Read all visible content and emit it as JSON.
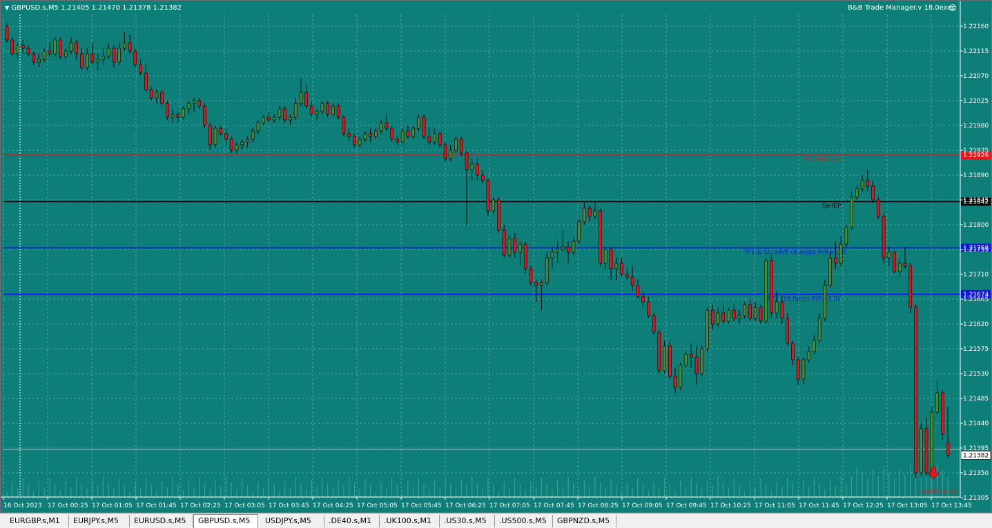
{
  "header": {
    "symbol_info": "GBPUSD.s,M5  1.21405 1.21470 1.21378 1.21382",
    "ea_label": "B&B Trade Manager.v 18.0exec"
  },
  "price_axis": {
    "ticks": [
      "1.22160",
      "1.22115",
      "1.22070",
      "1.22025",
      "1.21980",
      "1.21935",
      "1.21890",
      "1.21845",
      "1.21800",
      "1.21755",
      "1.21710",
      "1.21665",
      "1.21620",
      "1.21575",
      "1.21530",
      "1.21485",
      "1.21440",
      "1.21395",
      "1.21350",
      "1.21305"
    ],
    "current_price": "1.21382"
  },
  "time_axis": {
    "labels": [
      "16 Oct 2023",
      "17 Oct 00:25",
      "17 Oct 01:05",
      "17 Oct 01:45",
      "17 Oct 02:25",
      "17 Oct 03:05",
      "17 Oct 03:45",
      "17 Oct 04:25",
      "17 Oct 05:05",
      "17 Oct 05:45",
      "17 Oct 06:25",
      "17 Oct 07:05",
      "17 Oct 07:45",
      "17 Oct 08:25",
      "17 Oct 09:05",
      "17 Oct 09:45",
      "17 Oct 10:25",
      "17 Oct 11:05",
      "17 Oct 11:45",
      "17 Oct 12:25",
      "17 Oct 13:05",
      "17 Oct 13:45"
    ]
  },
  "levels": [
    {
      "name": "sl",
      "price": 1.21926,
      "price_label": "1.21926",
      "text": "SL (8.4pips)",
      "color": "#e8141a",
      "text_color": "#e8141a"
    },
    {
      "name": "sellep",
      "price": 1.21842,
      "price_label": "1.21842",
      "text": "SellEP",
      "color": "#000000",
      "text_color": "#000000"
    },
    {
      "name": "tp1",
      "price": 1.21758,
      "price_label": "1.21758",
      "text": "TP1 & SL->B/E (8.4pips R/R=1.0)",
      "color": "#0a14e6",
      "text_color": "#0a14e6"
    },
    {
      "name": "tp2",
      "price": 1.21674,
      "price_label": "1.21674",
      "text": "TP2 (16.8pips R/R=2.0)",
      "color": "#0a14e6",
      "text_color": "#0a14e6"
    }
  ],
  "sell_marker": {
    "text": "(5min 12:45)",
    "color": "#e8141a"
  },
  "chart_data": {
    "type": "candlestick",
    "symbol": "GBPUSD.s",
    "timeframe": "M5",
    "ylim": [
      1.213,
      1.2219
    ],
    "up_color": "#4f8a2c",
    "down_color": "#e8141a",
    "grid": true,
    "candles": [
      [
        1.2216,
        1.22165,
        1.2213,
        1.22135
      ],
      [
        1.22135,
        1.2214,
        1.22105,
        1.2211
      ],
      [
        1.2211,
        1.2213,
        1.221,
        1.22125
      ],
      [
        1.22125,
        1.22135,
        1.2211,
        1.2212
      ],
      [
        1.2212,
        1.22125,
        1.22105,
        1.2211
      ],
      [
        1.2211,
        1.22115,
        1.2209,
        1.22095
      ],
      [
        1.22095,
        1.2211,
        1.22085,
        1.221
      ],
      [
        1.221,
        1.2212,
        1.22095,
        1.22115
      ],
      [
        1.22115,
        1.2213,
        1.22105,
        1.2211
      ],
      [
        1.2211,
        1.2214,
        1.22105,
        1.22135
      ],
      [
        1.22135,
        1.2214,
        1.221,
        1.22105
      ],
      [
        1.22105,
        1.2212,
        1.221,
        1.22115
      ],
      [
        1.22115,
        1.2214,
        1.2211,
        1.2213
      ],
      [
        1.2213,
        1.22135,
        1.221,
        1.2211
      ],
      [
        1.2211,
        1.2212,
        1.2208,
        1.22085
      ],
      [
        1.22085,
        1.2212,
        1.2208,
        1.2211
      ],
      [
        1.2211,
        1.2213,
        1.2209,
        1.22095
      ],
      [
        1.22095,
        1.2211,
        1.2208,
        1.221
      ],
      [
        1.221,
        1.2212,
        1.2209,
        1.22105
      ],
      [
        1.22105,
        1.2213,
        1.221,
        1.2212
      ],
      [
        1.2212,
        1.22125,
        1.22085,
        1.22095
      ],
      [
        1.22095,
        1.2213,
        1.2209,
        1.2212
      ],
      [
        1.2212,
        1.2215,
        1.22115,
        1.2213
      ],
      [
        1.2213,
        1.22145,
        1.2211,
        1.22115
      ],
      [
        1.22115,
        1.2212,
        1.22085,
        1.2209
      ],
      [
        1.2209,
        1.221,
        1.2207,
        1.22075
      ],
      [
        1.22075,
        1.2209,
        1.2204,
        1.22045
      ],
      [
        1.22045,
        1.2205,
        1.22025,
        1.2203
      ],
      [
        1.2203,
        1.22045,
        1.2202,
        1.2204
      ],
      [
        1.2204,
        1.22045,
        1.22015,
        1.2202
      ],
      [
        1.2202,
        1.22025,
        1.2199,
        1.21995
      ],
      [
        1.21995,
        1.2201,
        1.21985,
        1.22
      ],
      [
        1.22,
        1.22005,
        1.21985,
        1.21995
      ],
      [
        1.21995,
        1.22015,
        1.2199,
        1.2201
      ],
      [
        1.2201,
        1.22025,
        1.22,
        1.2202
      ],
      [
        1.2202,
        1.2203,
        1.22005,
        1.22025
      ],
      [
        1.22025,
        1.2203,
        1.2201,
        1.22015
      ],
      [
        1.22015,
        1.2202,
        1.21975,
        1.2198
      ],
      [
        1.2198,
        1.21985,
        1.21935,
        1.21945
      ],
      [
        1.21945,
        1.2198,
        1.2194,
        1.21975
      ],
      [
        1.21975,
        1.2198,
        1.2196,
        1.21965
      ],
      [
        1.21965,
        1.21975,
        1.21945,
        1.21955
      ],
      [
        1.21955,
        1.2196,
        1.2193,
        1.21935
      ],
      [
        1.21935,
        1.2195,
        1.2193,
        1.21945
      ],
      [
        1.21945,
        1.21955,
        1.21935,
        1.2195
      ],
      [
        1.2195,
        1.2196,
        1.2194,
        1.21955
      ],
      [
        1.21955,
        1.21975,
        1.2195,
        1.2197
      ],
      [
        1.2197,
        1.2199,
        1.21965,
        1.21985
      ],
      [
        1.21985,
        1.22,
        1.2198,
        1.21995
      ],
      [
        1.21995,
        1.22005,
        1.21985,
        1.2199
      ],
      [
        1.2199,
        1.22,
        1.21985,
        1.21995
      ],
      [
        1.21995,
        1.22015,
        1.2199,
        1.2201
      ],
      [
        1.2201,
        1.22015,
        1.21985,
        1.2199
      ],
      [
        1.2199,
        1.22,
        1.2198,
        1.21995
      ],
      [
        1.21995,
        1.2203,
        1.2199,
        1.2202
      ],
      [
        1.2202,
        1.22065,
        1.22015,
        1.2204
      ],
      [
        1.2204,
        1.22055,
        1.2201,
        1.22015
      ],
      [
        1.22015,
        1.22025,
        1.21995,
        1.22
      ],
      [
        1.22,
        1.2201,
        1.2199,
        1.22005
      ],
      [
        1.22005,
        1.22025,
        1.22,
        1.2202
      ],
      [
        1.2202,
        1.22025,
        1.21995,
        1.22
      ],
      [
        1.22,
        1.2202,
        1.21995,
        1.22015
      ],
      [
        1.22015,
        1.2202,
        1.2199,
        1.21995
      ],
      [
        1.21995,
        1.22,
        1.2196,
        1.21965
      ],
      [
        1.21965,
        1.21975,
        1.2195,
        1.2196
      ],
      [
        1.2196,
        1.21965,
        1.2194,
        1.21945
      ],
      [
        1.21945,
        1.2196,
        1.2194,
        1.21955
      ],
      [
        1.21955,
        1.2197,
        1.2195,
        1.21965
      ],
      [
        1.21965,
        1.21975,
        1.2195,
        1.2196
      ],
      [
        1.2196,
        1.21975,
        1.21955,
        1.2197
      ],
      [
        1.2197,
        1.2199,
        1.21965,
        1.21985
      ],
      [
        1.21985,
        1.22,
        1.2197,
        1.21975
      ],
      [
        1.21975,
        1.2198,
        1.2195,
        1.21955
      ],
      [
        1.21955,
        1.2196,
        1.21945,
        1.2195
      ],
      [
        1.2195,
        1.21975,
        1.21945,
        1.2197
      ],
      [
        1.2197,
        1.2198,
        1.21955,
        1.2196
      ],
      [
        1.2196,
        1.2198,
        1.21955,
        1.21975
      ],
      [
        1.21975,
        1.22,
        1.2197,
        1.21995
      ],
      [
        1.21995,
        1.22,
        1.21955,
        1.2196
      ],
      [
        1.2196,
        1.21975,
        1.21945,
        1.2195
      ],
      [
        1.2195,
        1.21975,
        1.21945,
        1.21965
      ],
      [
        1.21965,
        1.2197,
        1.2194,
        1.21945
      ],
      [
        1.21945,
        1.2195,
        1.21915,
        1.2192
      ],
      [
        1.2192,
        1.21945,
        1.21915,
        1.21935
      ],
      [
        1.21935,
        1.2196,
        1.2193,
        1.21955
      ],
      [
        1.21955,
        1.2196,
        1.21925,
        1.2193
      ],
      [
        1.2193,
        1.21935,
        1.218,
        1.219
      ],
      [
        1.219,
        1.2192,
        1.2188,
        1.2191
      ],
      [
        1.2191,
        1.2192,
        1.2188,
        1.2189
      ],
      [
        1.2189,
        1.219,
        1.21875,
        1.2188
      ],
      [
        1.2188,
        1.21885,
        1.21815,
        1.21825
      ],
      [
        1.21825,
        1.2185,
        1.2182,
        1.21845
      ],
      [
        1.21845,
        1.2185,
        1.21785,
        1.2179
      ],
      [
        1.2179,
        1.218,
        1.2174,
        1.21745
      ],
      [
        1.21745,
        1.2178,
        1.2174,
        1.21775
      ],
      [
        1.21775,
        1.21785,
        1.2174,
        1.2175
      ],
      [
        1.2175,
        1.2177,
        1.21725,
        1.21765
      ],
      [
        1.21765,
        1.2177,
        1.2171,
        1.2172
      ],
      [
        1.2172,
        1.21725,
        1.2169,
        1.21695
      ],
      [
        1.21695,
        1.217,
        1.2166,
        1.2169
      ],
      [
        1.2169,
        1.217,
        1.21645,
        1.21695
      ],
      [
        1.21695,
        1.2175,
        1.2169,
        1.2174
      ],
      [
        1.2174,
        1.2176,
        1.2172,
        1.2175
      ],
      [
        1.2175,
        1.2177,
        1.2173,
        1.21755
      ],
      [
        1.21755,
        1.2179,
        1.2175,
        1.2176
      ],
      [
        1.2176,
        1.2177,
        1.2173,
        1.2175
      ],
      [
        1.2175,
        1.21775,
        1.21745,
        1.2177
      ],
      [
        1.2177,
        1.2181,
        1.21765,
        1.21805
      ],
      [
        1.21805,
        1.2184,
        1.218,
        1.2183
      ],
      [
        1.2183,
        1.21835,
        1.21805,
        1.21815
      ],
      [
        1.21815,
        1.2184,
        1.2181,
        1.21825
      ],
      [
        1.21825,
        1.2183,
        1.21725,
        1.2173
      ],
      [
        1.2173,
        1.2176,
        1.2172,
        1.21755
      ],
      [
        1.21755,
        1.2176,
        1.217,
        1.2172
      ],
      [
        1.2172,
        1.2174,
        1.217,
        1.2173
      ],
      [
        1.2173,
        1.2174,
        1.21705,
        1.2171
      ],
      [
        1.2171,
        1.2172,
        1.217,
        1.21705
      ],
      [
        1.21705,
        1.21725,
        1.2168,
        1.2169
      ],
      [
        1.2169,
        1.217,
        1.21665,
        1.2167
      ],
      [
        1.2167,
        1.2168,
        1.2165,
        1.2166
      ],
      [
        1.2166,
        1.2167,
        1.2163,
        1.21635
      ],
      [
        1.21635,
        1.2164,
        1.216,
        1.21605
      ],
      [
        1.21605,
        1.2161,
        1.2153,
        1.21535
      ],
      [
        1.21535,
        1.2159,
        1.2153,
        1.2158
      ],
      [
        1.2158,
        1.2159,
        1.2152,
        1.21525
      ],
      [
        1.21525,
        1.2154,
        1.21495,
        1.21505
      ],
      [
        1.21505,
        1.2155,
        1.215,
        1.21545
      ],
      [
        1.21545,
        1.2157,
        1.2154,
        1.21565
      ],
      [
        1.21565,
        1.21585,
        1.2154,
        1.2156
      ],
      [
        1.2156,
        1.2158,
        1.2151,
        1.2153
      ],
      [
        1.2153,
        1.2158,
        1.21525,
        1.21575
      ],
      [
        1.21575,
        1.2165,
        1.2157,
        1.21645
      ],
      [
        1.21645,
        1.21655,
        1.2161,
        1.2162
      ],
      [
        1.2162,
        1.2165,
        1.21615,
        1.2164
      ],
      [
        1.2164,
        1.21655,
        1.2162,
        1.21625
      ],
      [
        1.21625,
        1.2165,
        1.2162,
        1.21645
      ],
      [
        1.21645,
        1.21655,
        1.21625,
        1.2163
      ],
      [
        1.2163,
        1.21645,
        1.2162,
        1.21635
      ],
      [
        1.21635,
        1.2166,
        1.2163,
        1.21655
      ],
      [
        1.21655,
        1.21665,
        1.21625,
        1.2163
      ],
      [
        1.2163,
        1.2166,
        1.21625,
        1.2165
      ],
      [
        1.2165,
        1.21655,
        1.2162,
        1.21625
      ],
      [
        1.21625,
        1.2174,
        1.2162,
        1.21735
      ],
      [
        1.21735,
        1.21745,
        1.2163,
        1.2164
      ],
      [
        1.2164,
        1.2168,
        1.2163,
        1.2166
      ],
      [
        1.2166,
        1.2167,
        1.2162,
        1.2163
      ],
      [
        1.2163,
        1.2164,
        1.2158,
        1.21585
      ],
      [
        1.21585,
        1.2159,
        1.21545,
        1.21555
      ],
      [
        1.21555,
        1.2156,
        1.2151,
        1.2152
      ],
      [
        1.2152,
        1.2156,
        1.2151,
        1.21555
      ],
      [
        1.21555,
        1.2158,
        1.2155,
        1.2157
      ],
      [
        1.2157,
        1.216,
        1.21565,
        1.2159
      ],
      [
        1.2159,
        1.2164,
        1.21585,
        1.2163
      ],
      [
        1.2163,
        1.217,
        1.21625,
        1.2169
      ],
      [
        1.2169,
        1.2175,
        1.21685,
        1.2174
      ],
      [
        1.2174,
        1.2177,
        1.2172,
        1.2173
      ],
      [
        1.2173,
        1.2178,
        1.21725,
        1.21765
      ],
      [
        1.21765,
        1.218,
        1.2176,
        1.21795
      ],
      [
        1.21795,
        1.2186,
        1.2179,
        1.2185
      ],
      [
        1.2185,
        1.2187,
        1.21845,
        1.21865
      ],
      [
        1.21865,
        1.2189,
        1.2186,
        1.2188
      ],
      [
        1.2188,
        1.219,
        1.2186,
        1.2187
      ],
      [
        1.2187,
        1.2188,
        1.2184,
        1.21845
      ],
      [
        1.21845,
        1.2185,
        1.2181,
        1.21815
      ],
      [
        1.21815,
        1.2182,
        1.2173,
        1.2174
      ],
      [
        1.2174,
        1.2176,
        1.21725,
        1.2175
      ],
      [
        1.2175,
        1.21755,
        1.2171,
        1.21715
      ],
      [
        1.21715,
        1.2174,
        1.21705,
        1.2173
      ],
      [
        1.2173,
        1.2176,
        1.2172,
        1.21725
      ],
      [
        1.21725,
        1.2173,
        1.2164,
        1.2165
      ],
      [
        1.2165,
        1.21655,
        1.2134,
        1.2135
      ],
      [
        1.2135,
        1.2144,
        1.21345,
        1.2143
      ],
      [
        1.2143,
        1.2145,
        1.21345,
        1.2135
      ],
      [
        1.2135,
        1.2147,
        1.21345,
        1.2146
      ],
      [
        1.2146,
        1.21515,
        1.21455,
        1.21495
      ],
      [
        1.21495,
        1.215,
        1.2141,
        1.2142
      ],
      [
        1.21405,
        1.2147,
        1.21378,
        1.21382
      ]
    ]
  }
}
